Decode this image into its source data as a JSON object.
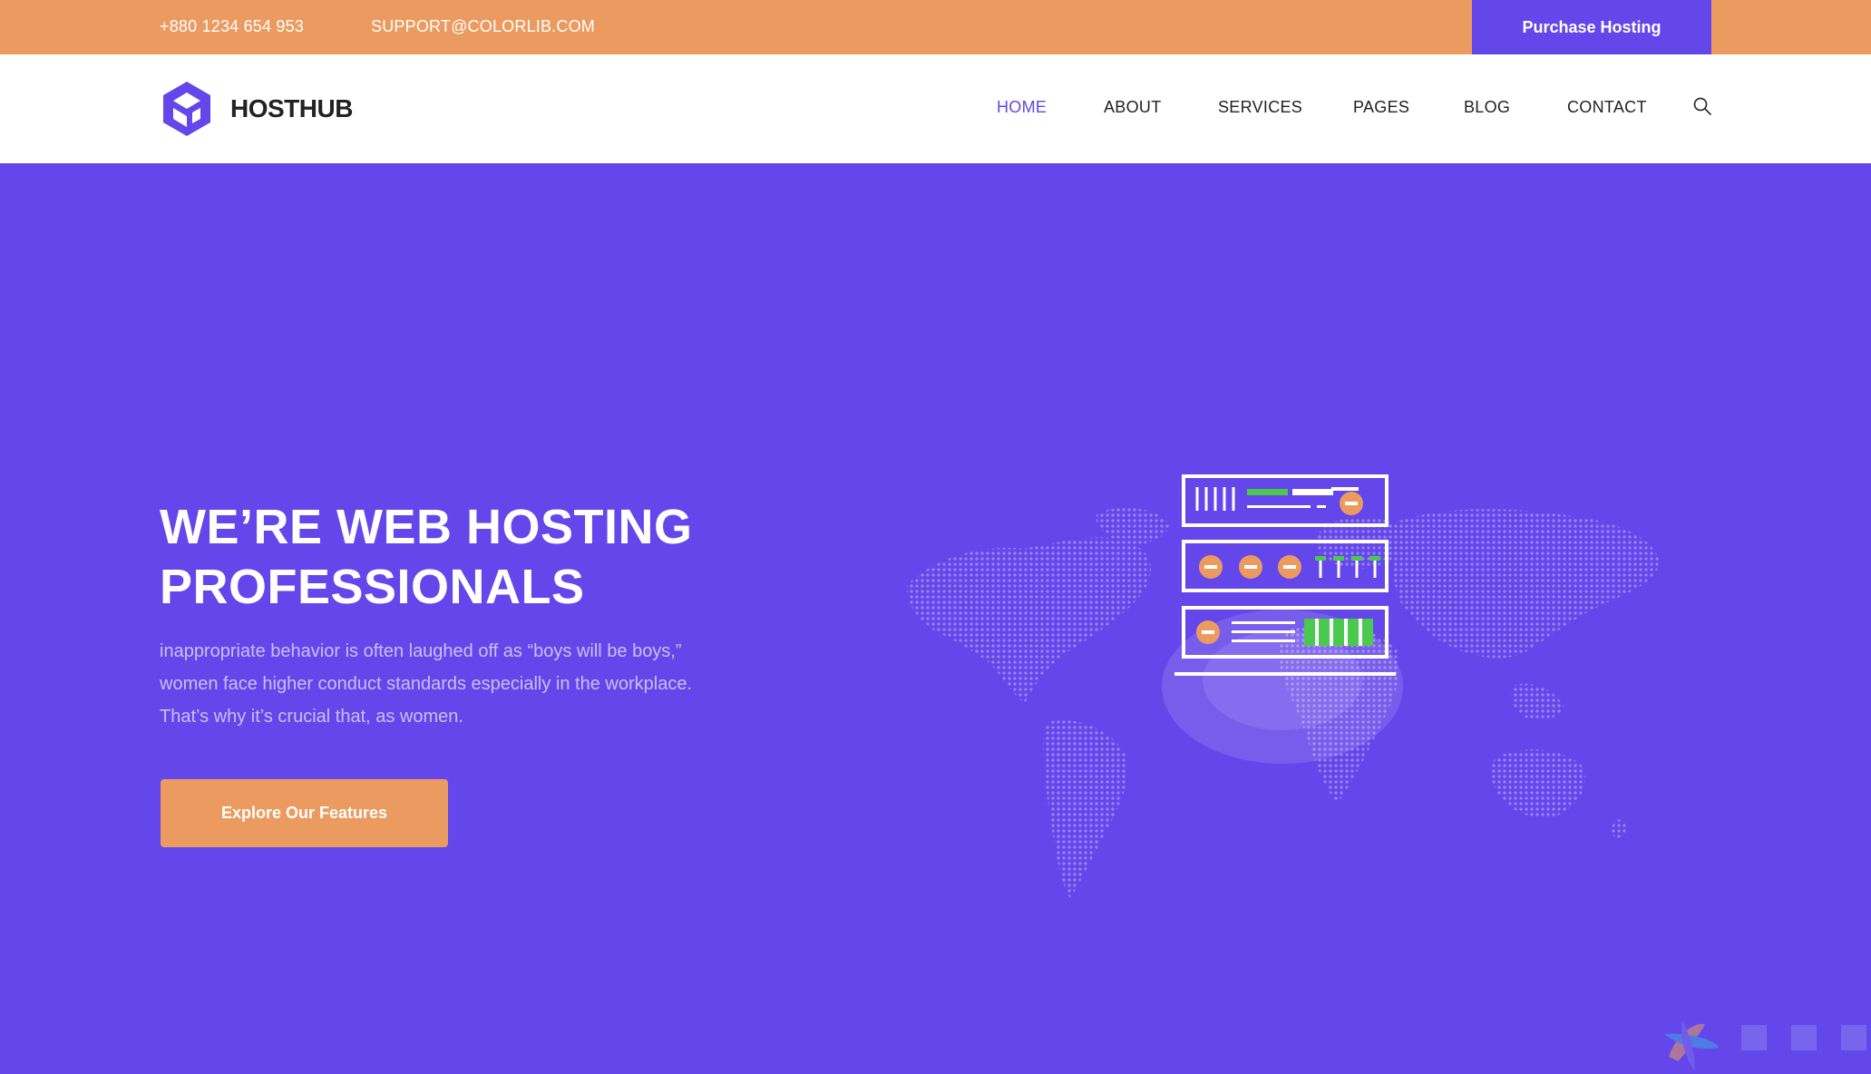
{
  "topbar": {
    "phone": "+880 1234 654 953",
    "email": "SUPPORT@COLORLIB.COM",
    "purchase_label": "Purchase Hosting"
  },
  "header": {
    "brand": "HOSTHUB",
    "nav": [
      {
        "label": "HOME",
        "active": true
      },
      {
        "label": "ABOUT"
      },
      {
        "label": "SERVICES"
      },
      {
        "label": "PAGES"
      },
      {
        "label": "BLOG"
      },
      {
        "label": "CONTACT"
      }
    ],
    "search_icon": "search-icon"
  },
  "hero": {
    "title_line1": "WE’RE WEB HOSTING",
    "title_line2": "PROFESSIONALS",
    "text": "inappropriate behavior is often laughed off as “boys will be boys,” women face higher conduct standards especially in the workplace. That’s why it’s crucial that, as women.",
    "cta_label": "Explore Our Features"
  },
  "colors": {
    "accent": "#6347ea",
    "orange": "#ec9b60",
    "white": "#ffffff"
  }
}
